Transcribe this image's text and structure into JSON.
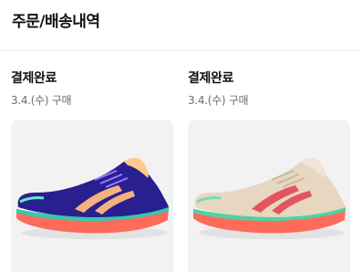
{
  "header": {
    "title": "주문/배송내역"
  },
  "orders": [
    {
      "status": "결제완료",
      "date_text": "3.4.(수) 구매",
      "product": {
        "icon": "running-shoe-icon",
        "colors": {
          "body": "#2a1f8f",
          "stripes": "#f3b37c",
          "sole": "#ff6b5a",
          "midsole_band": "#36c8b0"
        }
      }
    },
    {
      "status": "결제완료",
      "date_text": "3.4.(수) 구매",
      "product": {
        "icon": "running-shoe-icon",
        "colors": {
          "body": "#e7d7c1",
          "stripes": "#e2555e",
          "sole": "#ff6b5a",
          "midsole_band": "#4fd3a0"
        }
      }
    }
  ]
}
